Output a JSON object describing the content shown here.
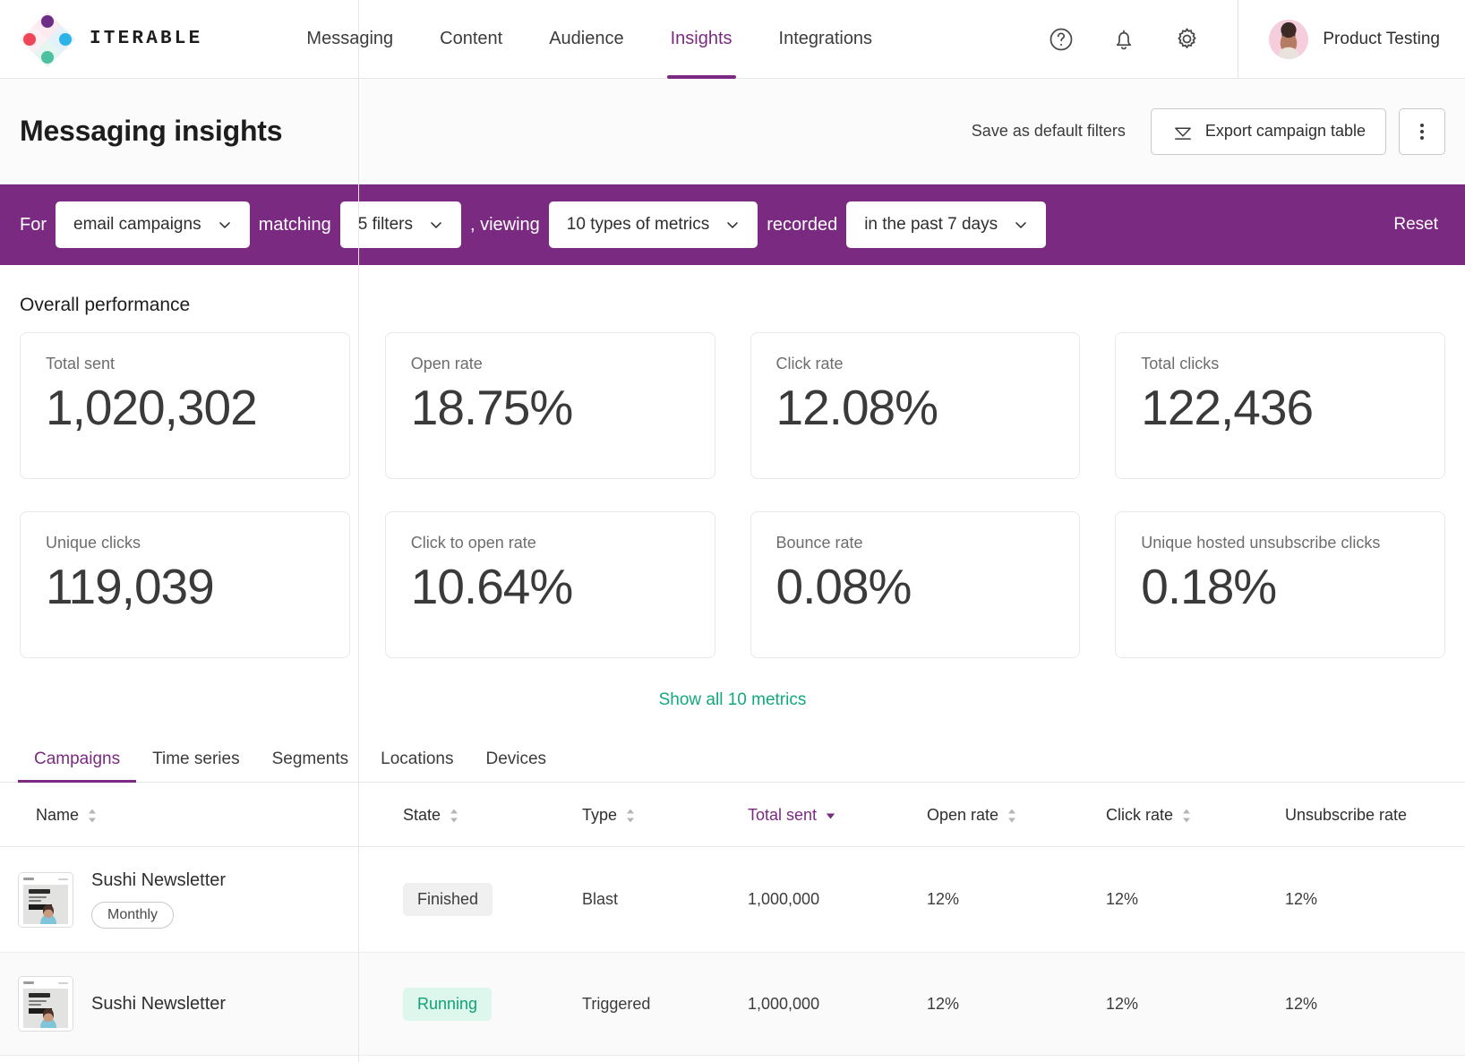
{
  "brand": {
    "name": "ITERABLE",
    "logo_icon": "iterable-diamond-logo"
  },
  "nav": {
    "links": [
      {
        "label": "Messaging",
        "active": false
      },
      {
        "label": "Content",
        "active": false
      },
      {
        "label": "Audience",
        "active": false
      },
      {
        "label": "Insights",
        "active": true
      },
      {
        "label": "Integrations",
        "active": false
      }
    ],
    "icons": [
      {
        "name": "help-icon",
        "glyph": "?"
      },
      {
        "name": "notifications-bell-icon",
        "glyph": "bell"
      },
      {
        "name": "settings-gear-icon",
        "glyph": "gear"
      }
    ],
    "account": {
      "name": "Product Testing",
      "avatar_icon": "user-avatar"
    }
  },
  "page": {
    "title": "Messaging insights",
    "save_default_filters": "Save as default filters",
    "export_button": "Export campaign table",
    "export_icon": "download-icon",
    "more_menu_icon": "kebab-menu-icon"
  },
  "filters": {
    "accent_color": "#7b2a82",
    "label_for": "For",
    "entity": "email campaigns",
    "label_matching": "matching",
    "filter_count": "5 filters",
    "label_viewing": ", viewing",
    "metrics": "10 types of metrics",
    "label_recorded": "recorded",
    "timeframe": "in the past 7 days",
    "reset": "Reset"
  },
  "overall": {
    "section_title": "Overall performance",
    "cards": [
      {
        "label": "Total sent",
        "value": "1,020,302"
      },
      {
        "label": "Open rate",
        "value": "18.75%"
      },
      {
        "label": "Click rate",
        "value": "12.08%"
      },
      {
        "label": "Total clicks",
        "value": "122,436"
      },
      {
        "label": "Unique clicks",
        "value": "119,039"
      },
      {
        "label": "Click to open rate",
        "value": "10.64%"
      },
      {
        "label": "Bounce rate",
        "value": "0.08%"
      },
      {
        "label": "Unique hosted unsubscribe clicks",
        "value": "0.18%"
      }
    ],
    "show_all_link": "Show all 10 metrics",
    "show_all_color": "#13a97d"
  },
  "tabs": [
    {
      "label": "Campaigns",
      "active": true
    },
    {
      "label": "Time series",
      "active": false
    },
    {
      "label": "Segments",
      "active": false
    },
    {
      "label": "Locations",
      "active": false
    },
    {
      "label": "Devices",
      "active": false
    }
  ],
  "table": {
    "columns": [
      {
        "label": "Name",
        "sorted": false,
        "sort_icon": "sort-updown-icon"
      },
      {
        "label": "State",
        "sorted": false,
        "sort_icon": "sort-updown-icon"
      },
      {
        "label": "Type",
        "sorted": false,
        "sort_icon": "sort-updown-icon"
      },
      {
        "label": "Total sent",
        "sorted": true,
        "sort_icon": "sort-descending-icon"
      },
      {
        "label": "Open rate",
        "sorted": false,
        "sort_icon": "sort-updown-icon"
      },
      {
        "label": "Click rate",
        "sorted": false,
        "sort_icon": "sort-updown-icon"
      },
      {
        "label": "Unsubscribe rate",
        "sorted": false,
        "sort_icon": "sort-updown-icon"
      }
    ],
    "rows": [
      {
        "name": "Sushi Newsletter",
        "tag": "Monthly",
        "thumbnail_icon": "campaign-thumbnail",
        "state": "Finished",
        "state_style": "finished",
        "type": "Blast",
        "total_sent": "1,000,000",
        "open_rate": "12%",
        "click_rate": "12%",
        "unsubscribe_rate": "12%"
      },
      {
        "name": "Sushi Newsletter",
        "tag": "",
        "thumbnail_icon": "campaign-thumbnail",
        "state": "Running",
        "state_style": "running",
        "type": "Triggered",
        "total_sent": "1,000,000",
        "open_rate": "12%",
        "click_rate": "12%",
        "unsubscribe_rate": "12%"
      }
    ]
  }
}
